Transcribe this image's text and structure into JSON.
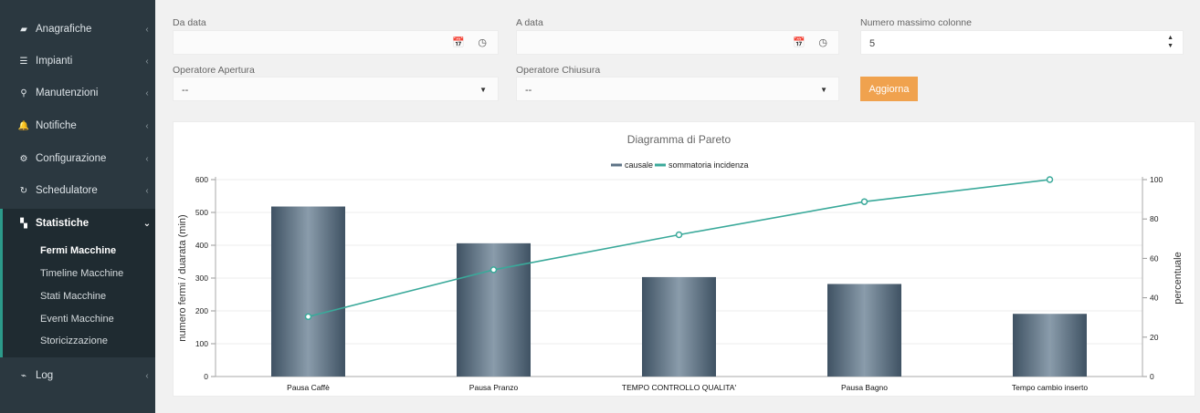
{
  "sidebar": {
    "items": [
      {
        "label": "Anagrafiche",
        "icon": "book-icon",
        "glyph": "▰"
      },
      {
        "label": "Impianti",
        "icon": "list-icon",
        "glyph": "☰"
      },
      {
        "label": "Manutenzioni",
        "icon": "search-icon",
        "glyph": "⚲"
      },
      {
        "label": "Notifiche",
        "icon": "bell-icon",
        "glyph": "🔔"
      },
      {
        "label": "Configurazione",
        "icon": "gears-icon",
        "glyph": "⚙"
      },
      {
        "label": "Schedulatore",
        "icon": "refresh-icon",
        "glyph": "↻"
      },
      {
        "label": "Statistiche",
        "icon": "map-icon",
        "glyph": "▚"
      },
      {
        "label": "Log",
        "icon": "paperclip-icon",
        "glyph": "⌁"
      }
    ],
    "sub_items": [
      "Fermi Macchine",
      "Timeline Macchine",
      "Stati Macchine",
      "Eventi Macchine",
      "Storicizzazione"
    ]
  },
  "filters": {
    "da_data_label": "Da data",
    "a_data_label": "A data",
    "max_cols_label": "Numero massimo colonne",
    "max_cols_value": "5",
    "op_apertura_label": "Operatore Apertura",
    "op_apertura_value": "--",
    "op_chiusura_label": "Operatore Chiusura",
    "op_chiusura_value": "--",
    "refresh_label": "Aggiorna"
  },
  "chart_data": {
    "type": "bar",
    "title": "Diagramma di Pareto",
    "categories": [
      "Pausa Caffè",
      "Pausa Pranzo",
      "TEMPO CONTROLLO QUALITA'",
      "Pausa Bagno",
      "Tempo cambio inserto"
    ],
    "series": [
      {
        "name": "causale",
        "type": "bar",
        "axis": "left",
        "values": [
          518,
          406,
          303,
          282,
          191
        ]
      },
      {
        "name": "sommatoria incidenza",
        "type": "line",
        "axis": "right",
        "values": [
          30.4,
          54.2,
          72,
          88.8,
          100
        ]
      }
    ],
    "ylabel": "numero fermi / duarata (min)",
    "y2label": "percentuale",
    "ylim": [
      0,
      600
    ],
    "y2lim": [
      0,
      100
    ],
    "yticks": [
      0,
      100,
      200,
      300,
      400,
      500,
      600
    ],
    "y2ticks": [
      0,
      20,
      40,
      60,
      80,
      100
    ],
    "legend": "top-center",
    "grid": true,
    "colors": {
      "bar": "#5d7386",
      "line": "#3aa99a"
    }
  }
}
